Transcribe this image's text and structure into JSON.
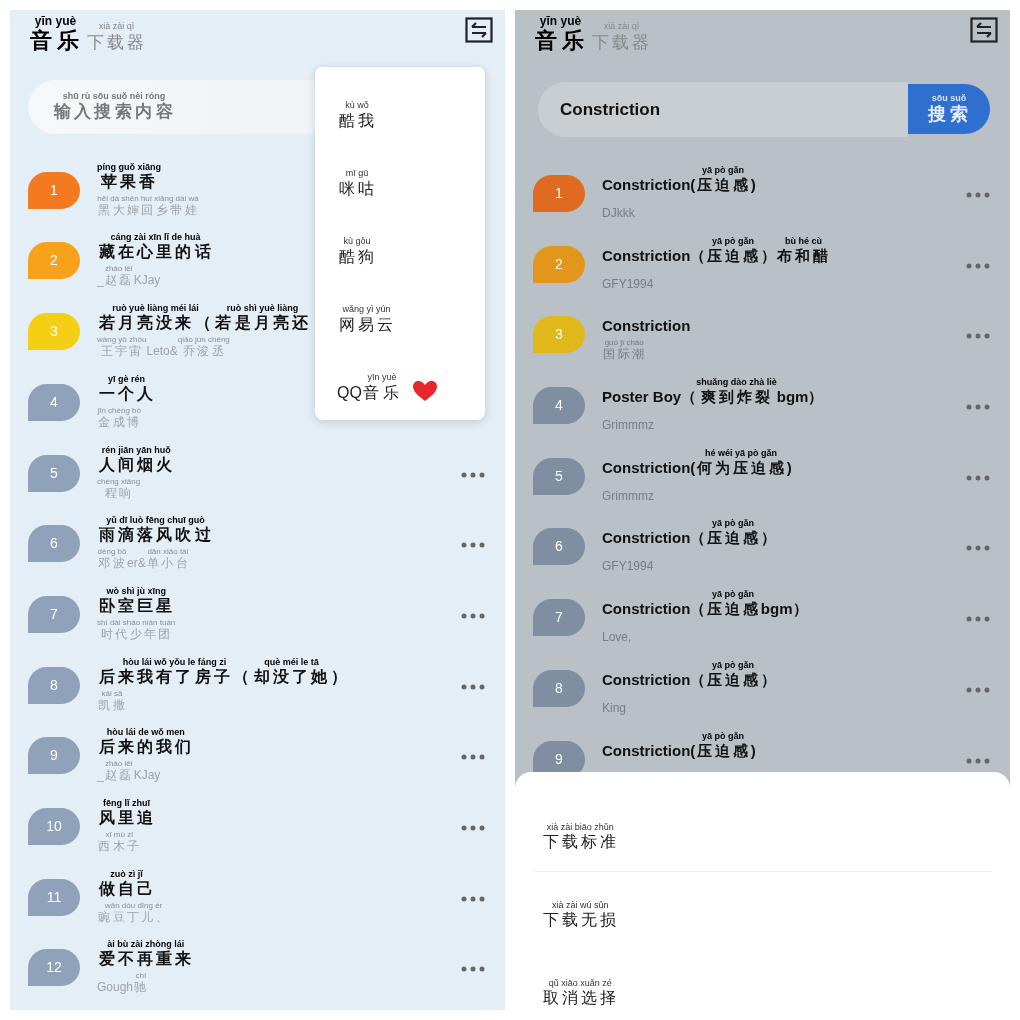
{
  "left_screen": {
    "header": {
      "title": [
        {
          "text": "音乐",
          "pinyin": "yīn yuè"
        }
      ],
      "subtitle": [
        {
          "text": "下载器",
          "pinyin": "xià zài qì"
        }
      ]
    },
    "search": {
      "placeholder": [
        {
          "text": "输入搜索内容",
          "pinyin": "shū rù sōu suǒ nèi róng"
        }
      ]
    },
    "songs": [
      {
        "number": "1",
        "color": "#f47a1f",
        "title": [
          {
            "text": "苹果香",
            "pinyin": "píng guǒ xiāng"
          }
        ],
        "artist": [
          {
            "text": "黑大婶回乡带娃",
            "pinyin": "hēi dà shěn huí xiāng dài wá"
          }
        ]
      },
      {
        "number": "2",
        "color": "#f7a21a",
        "title": [
          {
            "text": "藏在心里的话",
            "pinyin": "cáng zài xīn lǐ de huà"
          }
        ],
        "artist": [
          {
            "text": "_"
          },
          {
            "text": "赵磊",
            "pinyin": "zhào lěi"
          },
          {
            "text": "KJay"
          }
        ]
      },
      {
        "number": "3",
        "color": "#f5cf14",
        "title": [
          {
            "text": "若月亮没来（",
            "pinyin": "ruò yuè liàng méi lái"
          },
          {
            "text": "若是月亮还",
            "pinyin": "ruò shì yuè liàng"
          }
        ],
        "artist": [
          {
            "text": "王宇宙",
            "pinyin": "wáng yǔ zhòu"
          },
          {
            "text": "Leto&"
          },
          {
            "text": "乔浚丞",
            "pinyin": "qiáo jùn chéng"
          }
        ]
      },
      {
        "number": "4",
        "color": "#8fa2b9",
        "title": [
          {
            "text": "一个人",
            "pinyin": "yī gè rén"
          }
        ],
        "artist": [
          {
            "text": "金成博",
            "pinyin": "jīn chéng bó"
          }
        ]
      },
      {
        "number": "5",
        "color": "#8fa2b9",
        "title": [
          {
            "text": "人间烟火",
            "pinyin": "rén jiān yān huǒ"
          }
        ],
        "artist": [
          {
            "text": "程响",
            "pinyin": "chéng xiǎng"
          }
        ]
      },
      {
        "number": "6",
        "color": "#8fa2b9",
        "title": [
          {
            "text": "雨滴落风吹过",
            "pinyin": "yǔ dī luò fēng chuī guò"
          }
        ],
        "artist": [
          {
            "text": "邓波",
            "pinyin": "dèng bō"
          },
          {
            "text": "er&"
          },
          {
            "text": "单小台",
            "pinyin": "dān xiǎo tái"
          }
        ]
      },
      {
        "number": "7",
        "color": "#8fa2b9",
        "title": [
          {
            "text": "卧室巨星",
            "pinyin": "wò shì jù xīng"
          }
        ],
        "artist": [
          {
            "text": "时代少年团",
            "pinyin": "shí dài shào nián tuán"
          }
        ]
      },
      {
        "number": "8",
        "color": "#8fa2b9",
        "title": [
          {
            "text": "后来我有了房子（",
            "pinyin": "hòu lái wǒ yǒu le fáng zi"
          },
          {
            "text": "却没了她",
            "pinyin": "què méi le tā"
          },
          {
            "text": "）"
          }
        ],
        "artist": [
          {
            "text": "凯撒",
            "pinyin": "kǎi sā"
          }
        ]
      },
      {
        "number": "9",
        "color": "#8fa2b9",
        "title": [
          {
            "text": "后来的我们",
            "pinyin": "hòu lái de wǒ men"
          }
        ],
        "artist": [
          {
            "text": "_"
          },
          {
            "text": "赵磊",
            "pinyin": "zhào lěi"
          },
          {
            "text": "KJay"
          }
        ]
      },
      {
        "number": "10",
        "color": "#8fa2b9",
        "title": [
          {
            "text": "风里追",
            "pinyin": "fēng lǐ zhuī"
          }
        ],
        "artist": [
          {
            "text": "西木子",
            "pinyin": "xī mù zǐ"
          }
        ]
      },
      {
        "number": "11",
        "color": "#8fa2b9",
        "title": [
          {
            "text": "做自己",
            "pinyin": "zuò zì jǐ"
          }
        ],
        "artist": [
          {
            "text": "豌豆丁儿、",
            "pinyin": "wān dòu dīng ér"
          }
        ]
      },
      {
        "number": "12",
        "color": "#8fa2b9",
        "title": [
          {
            "text": "爱不再重来",
            "pinyin": "ài bù zài zhòng lái"
          }
        ],
        "artist": [
          {
            "text": "Gough"
          },
          {
            "text": "驰",
            "pinyin": "chí"
          }
        ]
      }
    ],
    "source_menu": {
      "items": [
        {
          "label": [
            {
              "text": "酷我",
              "pinyin": "kù wǒ"
            }
          ],
          "favorite": false
        },
        {
          "label": [
            {
              "text": "咪咕",
              "pinyin": "mī gū"
            }
          ],
          "favorite": false
        },
        {
          "label": [
            {
              "text": "酷狗",
              "pinyin": "kù gǒu"
            }
          ],
          "favorite": false
        },
        {
          "label": [
            {
              "text": "网易云",
              "pinyin": "wǎng yì yún"
            }
          ],
          "favorite": false
        },
        {
          "label": [
            {
              "text": "QQ"
            },
            {
              "text": "音乐",
              "pinyin": "yīn yuè"
            }
          ],
          "favorite": true
        }
      ]
    }
  },
  "right_screen": {
    "header": {
      "title": [
        {
          "text": "音乐",
          "pinyin": "yīn yuè"
        }
      ],
      "subtitle": [
        {
          "text": "下载器",
          "pinyin": "xià zài qì"
        }
      ]
    },
    "search": {
      "value": "Constriction",
      "button": [
        {
          "text": "搜索",
          "pinyin": "sōu suǒ"
        }
      ]
    },
    "songs": [
      {
        "number": "1",
        "color": "#e06a20",
        "title": [
          {
            "text": "Constriction("
          },
          {
            "text": "压迫感",
            "pinyin": "yā pò gǎn"
          },
          {
            "text": ")"
          }
        ],
        "artist": [
          {
            "text": "DJkkk"
          }
        ]
      },
      {
        "number": "2",
        "color": "#e3961c",
        "title": [
          {
            "text": "Constriction（"
          },
          {
            "text": "压迫感",
            "pinyin": "yā pò gǎn"
          },
          {
            "text": "）"
          },
          {
            "text": "布和醋",
            "pinyin": "bù hé cù"
          }
        ],
        "artist": [
          {
            "text": "GFY1994"
          }
        ]
      },
      {
        "number": "3",
        "color": "#e0b81c",
        "title": [
          {
            "text": "Constriction"
          }
        ],
        "artist": [
          {
            "text": "国际潮",
            "pinyin": "guó jì cháo"
          }
        ]
      },
      {
        "number": "4",
        "color": "#7f8ea0",
        "title": [
          {
            "text": "Poster Boy（"
          },
          {
            "text": "爽到炸裂",
            "pinyin": "shuǎng dào zhà liè"
          },
          {
            "text": "bgm）"
          }
        ],
        "artist": [
          {
            "text": "Grimmmz"
          }
        ]
      },
      {
        "number": "5",
        "color": "#7f8ea0",
        "title": [
          {
            "text": "Constriction("
          },
          {
            "text": "何为压迫感",
            "pinyin": "hé wéi yā pò gǎn"
          },
          {
            "text": ")"
          }
        ],
        "artist": [
          {
            "text": "Grimmmz"
          }
        ]
      },
      {
        "number": "6",
        "color": "#7f8ea0",
        "title": [
          {
            "text": "Constriction（"
          },
          {
            "text": "压迫感",
            "pinyin": "yā pò gǎn"
          },
          {
            "text": "）"
          }
        ],
        "artist": [
          {
            "text": "GFY1994"
          }
        ]
      },
      {
        "number": "7",
        "color": "#7f8ea0",
        "title": [
          {
            "text": "Constriction（"
          },
          {
            "text": "压迫感",
            "pinyin": "yā pò gǎn"
          },
          {
            "text": "bgm）"
          }
        ],
        "artist": [
          {
            "text": "Love,"
          }
        ]
      },
      {
        "number": "8",
        "color": "#7f8ea0",
        "title": [
          {
            "text": "Constriction（"
          },
          {
            "text": "压迫感",
            "pinyin": "yā pò gǎn"
          },
          {
            "text": "）"
          }
        ],
        "artist": [
          {
            "text": "King"
          }
        ]
      },
      {
        "number": "9",
        "color": "#7f8ea0",
        "title": [
          {
            "text": "Constriction("
          },
          {
            "text": "压迫感",
            "pinyin": "yā pò gǎn"
          },
          {
            "text": ")"
          }
        ]
      }
    ],
    "download_sheet": {
      "options": [
        [
          {
            "text": "下载标准",
            "pinyin": "xià zài biāo zhǔn"
          }
        ],
        [
          {
            "text": "下载无损",
            "pinyin": "xià zài wú sǔn"
          }
        ],
        [
          {
            "text": "取消选择",
            "pinyin": "qǔ xiāo xuǎn zé"
          }
        ]
      ]
    }
  }
}
